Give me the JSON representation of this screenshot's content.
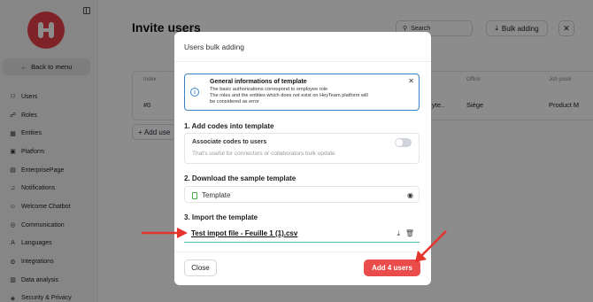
{
  "sidebar": {
    "back_label": "Back to menu",
    "items": [
      {
        "label": "Users",
        "icon": "users-icon"
      },
      {
        "label": "Roles",
        "icon": "roles-icon"
      },
      {
        "label": "Entities",
        "icon": "entities-icon"
      },
      {
        "label": "Platform",
        "icon": "platform-icon"
      },
      {
        "label": "EnterprisePage",
        "icon": "enterprise-page-icon"
      },
      {
        "label": "Notifications",
        "icon": "bell-icon"
      },
      {
        "label": "Welcome Chatbot",
        "icon": "chatbot-icon"
      },
      {
        "label": "Communication",
        "icon": "communication-icon"
      },
      {
        "label": "Languages",
        "icon": "languages-icon"
      },
      {
        "label": "Integrations",
        "icon": "integrations-icon"
      },
      {
        "label": "Data analysis",
        "icon": "data-analysis-icon"
      },
      {
        "label": "Security & Privacy",
        "icon": "shield-icon"
      }
    ]
  },
  "page": {
    "title": "Invite users",
    "search_placeholder": "Search",
    "bulk_label": "Bulk adding",
    "add_user_label": "Add use",
    "table": {
      "headers": [
        "Index",
        "Office",
        "Job positi"
      ],
      "row": {
        "index": "#0",
        "partial": "yte..",
        "office": "Siège",
        "job": "Product M"
      }
    }
  },
  "modal": {
    "title": "Users bulk adding",
    "info": {
      "title": "General informations of template",
      "lines": [
        "The basic authorizations correspond to employee role",
        "The roles and the entities which does not exist on HeyTeam platform will",
        "be considered as error"
      ]
    },
    "section1": {
      "title": "1. Add codes into template",
      "toggle_label": "Associate codes to users",
      "toggle_help": "That's useful for connectors or collaborators bulk update",
      "toggle_on": false
    },
    "section2": {
      "title": "2. Download the sample template",
      "template_label": "Template"
    },
    "section3": {
      "title": "3. Import the template",
      "file_name": "Test impot file - Feuille 1 (1).csv"
    },
    "close_label": "Close",
    "submit_label": "Add 4 users"
  },
  "colors": {
    "brand": "#e8404b",
    "submit": "#ea4b4b",
    "info_border": "#3b82c4",
    "file_underline": "#4dc1b0",
    "annotation_arrow": "#e5342b"
  }
}
